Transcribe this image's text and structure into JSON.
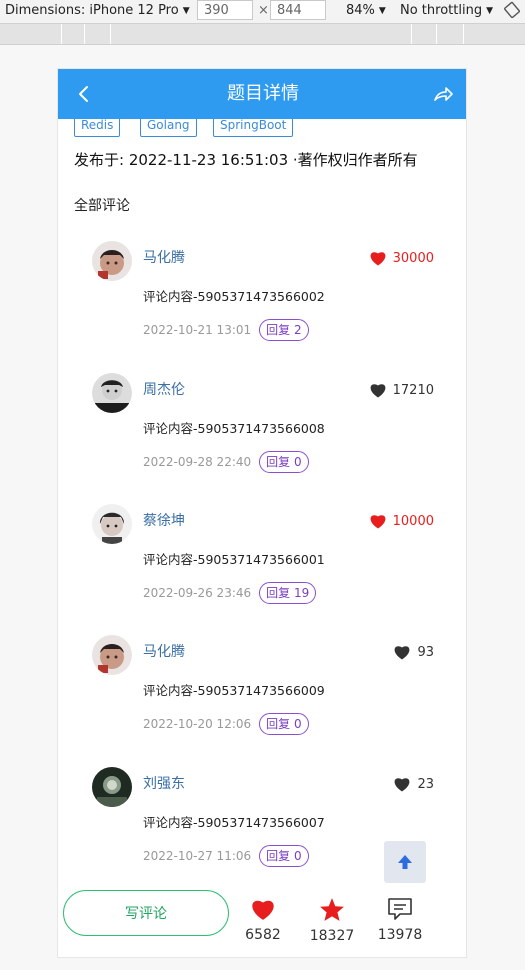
{
  "devtools": {
    "dimensions_label": "Dimensions: iPhone 12 Pro",
    "width": "390",
    "times": "×",
    "height": "844",
    "zoom": "84%",
    "throttle": "No throttling"
  },
  "header": {
    "title": "题目详情"
  },
  "tags": [
    "Redis",
    "Golang",
    "SpringBoot"
  ],
  "publish_text": "发布于: 2022-11-23 16:51:03  ·著作权归作者所有",
  "all_comments_label": "全部评论",
  "comments": [
    {
      "name": "马化腾",
      "text": "评论内容-5905371473566002",
      "date": "2022-10-21 13:01",
      "reply": "回复 2",
      "likes": "30000",
      "liked": true
    },
    {
      "name": "周杰伦",
      "text": "评论内容-5905371473566008",
      "date": "2022-09-28 22:40",
      "reply": "回复 0",
      "likes": "17210",
      "liked": false
    },
    {
      "name": "蔡徐坤",
      "text": "评论内容-5905371473566001",
      "date": "2022-09-26 23:46",
      "reply": "回复 19",
      "likes": "10000",
      "liked": true
    },
    {
      "name": "马化腾",
      "text": "评论内容-5905371473566009",
      "date": "2022-10-20 12:06",
      "reply": "回复 0",
      "likes": "93",
      "liked": false
    },
    {
      "name": "刘强东",
      "text": "评论内容-5905371473566007",
      "date": "2022-10-27 11:06",
      "reply": "回复 0",
      "likes": "23",
      "liked": false
    }
  ],
  "bottom": {
    "write_label": "写评论",
    "like_count": "6582",
    "star_count": "18327",
    "comment_count": "13978"
  },
  "colors": {
    "header_bg": "#2e9bf0",
    "liked": "#e81e1e",
    "reply": "#7a3ec1",
    "write": "#22a463"
  }
}
